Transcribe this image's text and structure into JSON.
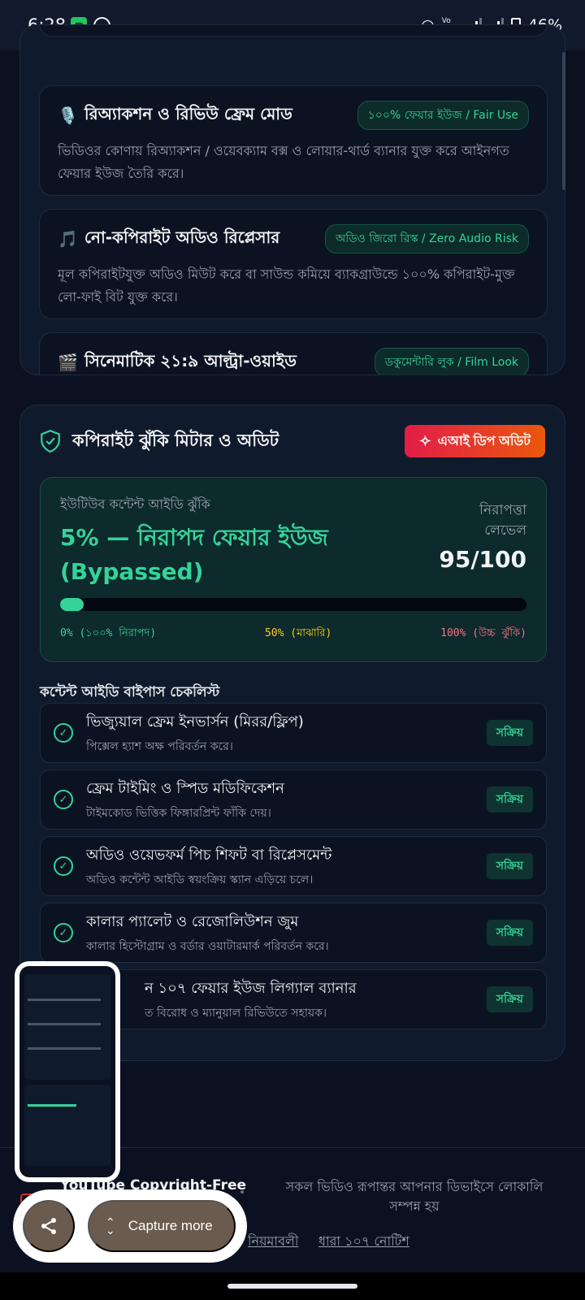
{
  "status_bar": {
    "time": "6:28",
    "battery": "46%",
    "network": "Vo LTE"
  },
  "features": [
    {
      "icon": "🎙️",
      "title": "রিঅ্যাকশন ও রিভিউ ফ্রেম মোড",
      "badge": "১০০% ফেয়ার ইউজ / Fair Use",
      "desc": "ভিডিওর কোণায় রিঅ্যাকশন / ওয়েবক্যাম বক্স ও লোয়ার-থার্ড ব্যানার যুক্ত করে আইনগত ফেয়ার ইউজ তৈরি করে।"
    },
    {
      "icon": "🎵",
      "title": "নো-কপিরাইট অডিও রিপ্লেসার",
      "badge": "অডিও জিরো রিস্ক / Zero Audio Risk",
      "desc": "মূল কপিরাইটযুক্ত অডিও মিউট করে বা সাউন্ড কমিয়ে ব্যাকগ্রাউন্ডে ১০০% কপিরাইট-মুক্ত লো-ফাই বিট যুক্ত করে।"
    },
    {
      "icon": "🎬",
      "title": "সিনেমাটিক ২১:৯ আল্ট্রা-ওয়াইড",
      "badge": "ডকুমেন্টারি লুক / Film Look",
      "desc": ""
    }
  ],
  "meter": {
    "title": "কপিরাইট ঝুঁকি মিটার ও অডিট",
    "audit_button": "এআই ডিপ অডিট",
    "risk_label": "ইউটিউব কন্টেন্ট আইডি ঝুঁকি",
    "risk_value": "5% — নিরাপদ ফেয়ার ইউজ (Bypassed)",
    "risk_percent": 5,
    "safety_label": "নিরাপত্তা লেভেল",
    "safety_score": "95/100",
    "scale_low": "0% (১০০% নিরাপদ)",
    "scale_mid": "50% (মাঝারি)",
    "scale_high": "100% (উচ্চ ঝুঁকি)"
  },
  "checklist": {
    "title": "কন্টেন্ট আইডি বাইপাস চেকলিস্ট",
    "items": [
      {
        "title": "ভিজ্যুয়াল ফ্রেম ইনভার্সন (মিরর/ফ্লিপ)",
        "sub": "পিক্সেল হ্যাশ অক্ষ পরিবর্তন করে।",
        "status": "সক্রিয়"
      },
      {
        "title": "ফ্রেম টাইমিং ও স্পিড মডিফিকেশন",
        "sub": "টাইমকোড ভিত্তিক ফিঙ্গারপ্রিন্ট ফাঁকি দেয়।",
        "status": "সক্রিয়"
      },
      {
        "title": "অডিও ওয়েভফর্ম পিচ শিফট বা রিপ্লেসমেন্ট",
        "sub": "অডিও কন্টেন্ট আইডি স্বয়ংক্রিয় স্ক্যান এড়িয়ে চলে।",
        "status": "সক্রিয়"
      },
      {
        "title": "কালার প্যালেট ও রেজোলিউশন জুম",
        "sub": "কালার হিস্টোগ্রাম ও বর্ডার ওয়াটারমার্ক পরিবর্তন করে।",
        "status": "সক্রিয়"
      },
      {
        "title": "ন ১০৭ ফেয়ার ইউজ লিগ্যাল ব্যানার",
        "sub": "ত বিরোধ ও ম্যানুয়াল রিভিউতে সহায়ক।",
        "status": "সক্রিয়"
      }
    ]
  },
  "footer": {
    "brand": "YouTube Copyright-Free",
    "note": "সকল ভিডিও রূপান্তর আপনার ডিভাইসে লোকালি সম্পন্ন হয়",
    "link_rules": "নিয়মাবলী",
    "link_notice": "ধারা ১০৭ নোটিশ"
  },
  "screenshot_overlay": {
    "capture_label": "Capture more"
  },
  "colors": {
    "accent": "#34d399",
    "background": "#0b1120",
    "card": "#101a2d",
    "danger": "#e11d48"
  }
}
